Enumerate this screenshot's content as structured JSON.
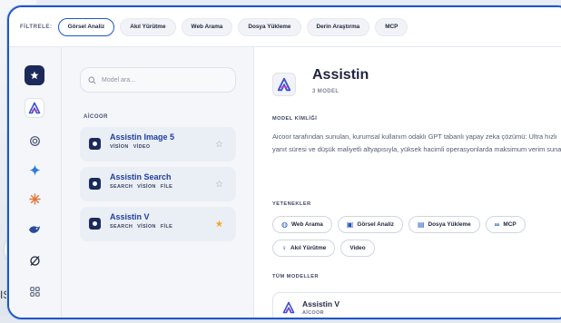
{
  "filters": {
    "label": "FİLTRELE:",
    "chips": [
      {
        "label": "Görsel Analiz",
        "active": true
      },
      {
        "label": "Akıl Yürütme",
        "active": false
      },
      {
        "label": "Web Arama",
        "active": false
      },
      {
        "label": "Dosya Yükleme",
        "active": false
      },
      {
        "label": "Derin Araştırma",
        "active": false
      },
      {
        "label": "MCP",
        "active": false
      }
    ]
  },
  "rail": {
    "icons": [
      "star-icon",
      "assistin-logo-icon",
      "openai-icon",
      "gemini-icon",
      "claude-icon",
      "deepseek-icon",
      "grok-icon",
      "grid-icon"
    ]
  },
  "list": {
    "search_placeholder": "Model ara...",
    "section": "AİCOOR",
    "models": [
      {
        "name": "Assistin Image 5",
        "tags": [
          "VİSİON",
          "VİDEO"
        ],
        "favorite": false
      },
      {
        "name": "Assistin Search",
        "tags": [
          "SEARCH",
          "VİSİON",
          "FİLE"
        ],
        "favorite": false
      },
      {
        "name": "Assistin V",
        "tags": [
          "SEARCH",
          "VİSİON",
          "FİLE"
        ],
        "favorite": true
      }
    ]
  },
  "detail": {
    "title": "Assistin",
    "subtitle": "3 MODEL",
    "identity_label": "MODEL KİMLİĞİ",
    "description": "Aicoor tarafından sunulan, kurumsal kullanım odaklı GPT tabanlı yapay zeka çözümü: Ultra hızlı yanıt süresi ve düşük maliyetli altyapısıyla, yüksek hacimli operasyonlarda maksimum verim sunar.",
    "capabilities_label": "YETENEKLER",
    "capabilities": [
      {
        "label": "Web Arama",
        "icon": "globe-icon"
      },
      {
        "label": "Görsel Analiz",
        "icon": "image-icon"
      },
      {
        "label": "Dosya Yükleme",
        "icon": "file-icon"
      },
      {
        "label": "MCP",
        "icon": "link-icon"
      },
      {
        "label": "Akıl Yürütme",
        "icon": "bulb-icon"
      },
      {
        "label": "Video",
        "icon": ""
      }
    ],
    "all_models_label": "TÜM MODELLER",
    "all_models": [
      {
        "name": "Assistin V",
        "org": "AİCOOR"
      }
    ]
  },
  "background": {
    "partial_text": "ISI"
  },
  "colors": {
    "accent": "#1f57c7",
    "favorite": "#f2a526",
    "model_name": "#1f3f9d"
  }
}
